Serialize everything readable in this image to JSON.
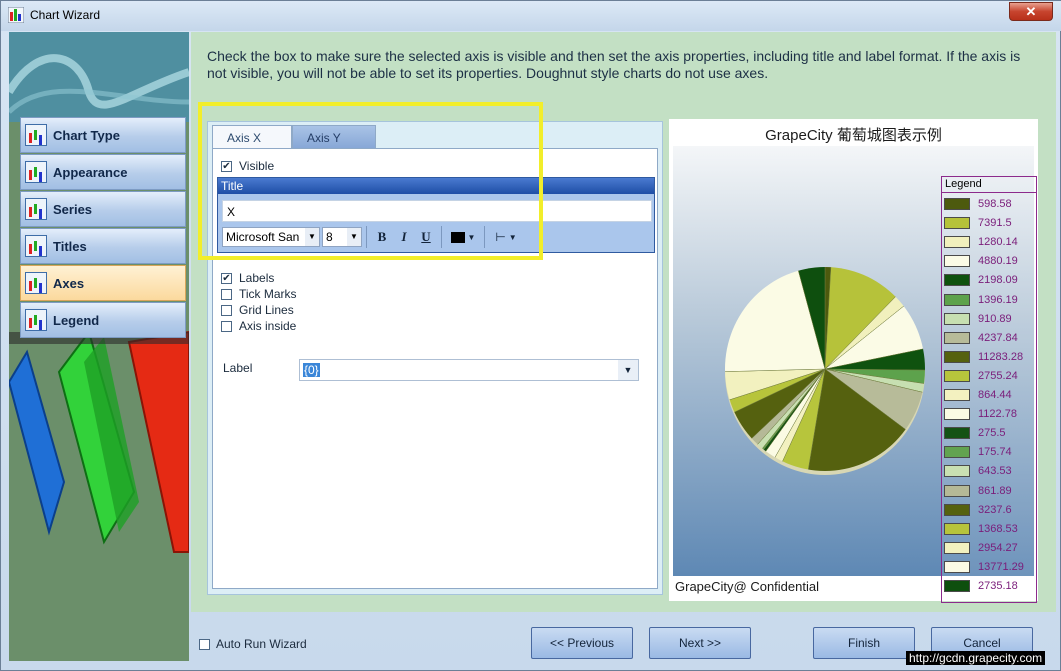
{
  "window": {
    "title": "Chart Wizard",
    "close_label": "✕"
  },
  "nav": {
    "items": [
      {
        "label": "Chart Type"
      },
      {
        "label": "Appearance"
      },
      {
        "label": "Series"
      },
      {
        "label": "Titles"
      },
      {
        "label": "Axes"
      },
      {
        "label": "Legend"
      }
    ],
    "active": "Axes"
  },
  "instructions": "Check the box to make sure the selected axis is visible and then set the axis properties, including title and label format.  If the axis is not visible, you will not be able to set its properties.  Doughnut style charts do not use axes.",
  "tabs": [
    {
      "label": "Axis X"
    },
    {
      "label": "Axis Y"
    }
  ],
  "axis": {
    "visible_label": "Visible",
    "visible_checked": "✔",
    "title_group_label": "Title",
    "title_value": "X",
    "font_name": "Microsoft San",
    "font_size": "8",
    "bold_label": "B",
    "italic_label": "I",
    "underline_label": "U",
    "options": [
      {
        "label": "Labels",
        "checked": "✔"
      },
      {
        "label": "Tick Marks",
        "checked": ""
      },
      {
        "label": "Grid Lines",
        "checked": ""
      },
      {
        "label": "Axis inside",
        "checked": ""
      }
    ],
    "label_field_label": "Label",
    "label_format": "{0}"
  },
  "chart": {
    "title": "GrapeCity 葡萄城图表示例",
    "legend_title": "Legend",
    "footer": "GrapeCity@ Confidential",
    "legend": [
      {
        "value": "598.58",
        "color": "#4d5a0e"
      },
      {
        "value": "7391.5",
        "color": "#b6c23a"
      },
      {
        "value": "1280.14",
        "color": "#f1f0bd"
      },
      {
        "value": "4880.19",
        "color": "#fbfbe6"
      },
      {
        "value": "2198.09",
        "color": "#0f520f"
      },
      {
        "value": "1396.19",
        "color": "#5da24c"
      },
      {
        "value": "910.89",
        "color": "#c7dfb1"
      },
      {
        "value": "4237.84",
        "color": "#b7bb99"
      },
      {
        "value": "11283.28",
        "color": "#55610f"
      },
      {
        "value": "2755.24",
        "color": "#b7c53c"
      },
      {
        "value": "864.44",
        "color": "#f3f1c0"
      },
      {
        "value": "1122.78",
        "color": "#fbfbe4"
      },
      {
        "value": "275.5",
        "color": "#145214"
      },
      {
        "value": "175.74",
        "color": "#62a350"
      },
      {
        "value": "643.53",
        "color": "#c9e0b2"
      },
      {
        "value": "861.89",
        "color": "#b5b997"
      },
      {
        "value": "3237.6",
        "color": "#55610f"
      },
      {
        "value": "1368.53",
        "color": "#b7c43b"
      },
      {
        "value": "2954.27",
        "color": "#f2f1bf"
      },
      {
        "value": "13771.29",
        "color": "#fbfbe5"
      },
      {
        "value": "2735.18",
        "color": "#0e4f0e"
      }
    ]
  },
  "footer": {
    "auto_run_label": "Auto Run Wizard",
    "previous_label": "<< Previous",
    "next_label": "Next >>",
    "finish_label": "Finish",
    "cancel_label": "Cancel",
    "watermark": "http://gcdn.grapecity.com"
  }
}
